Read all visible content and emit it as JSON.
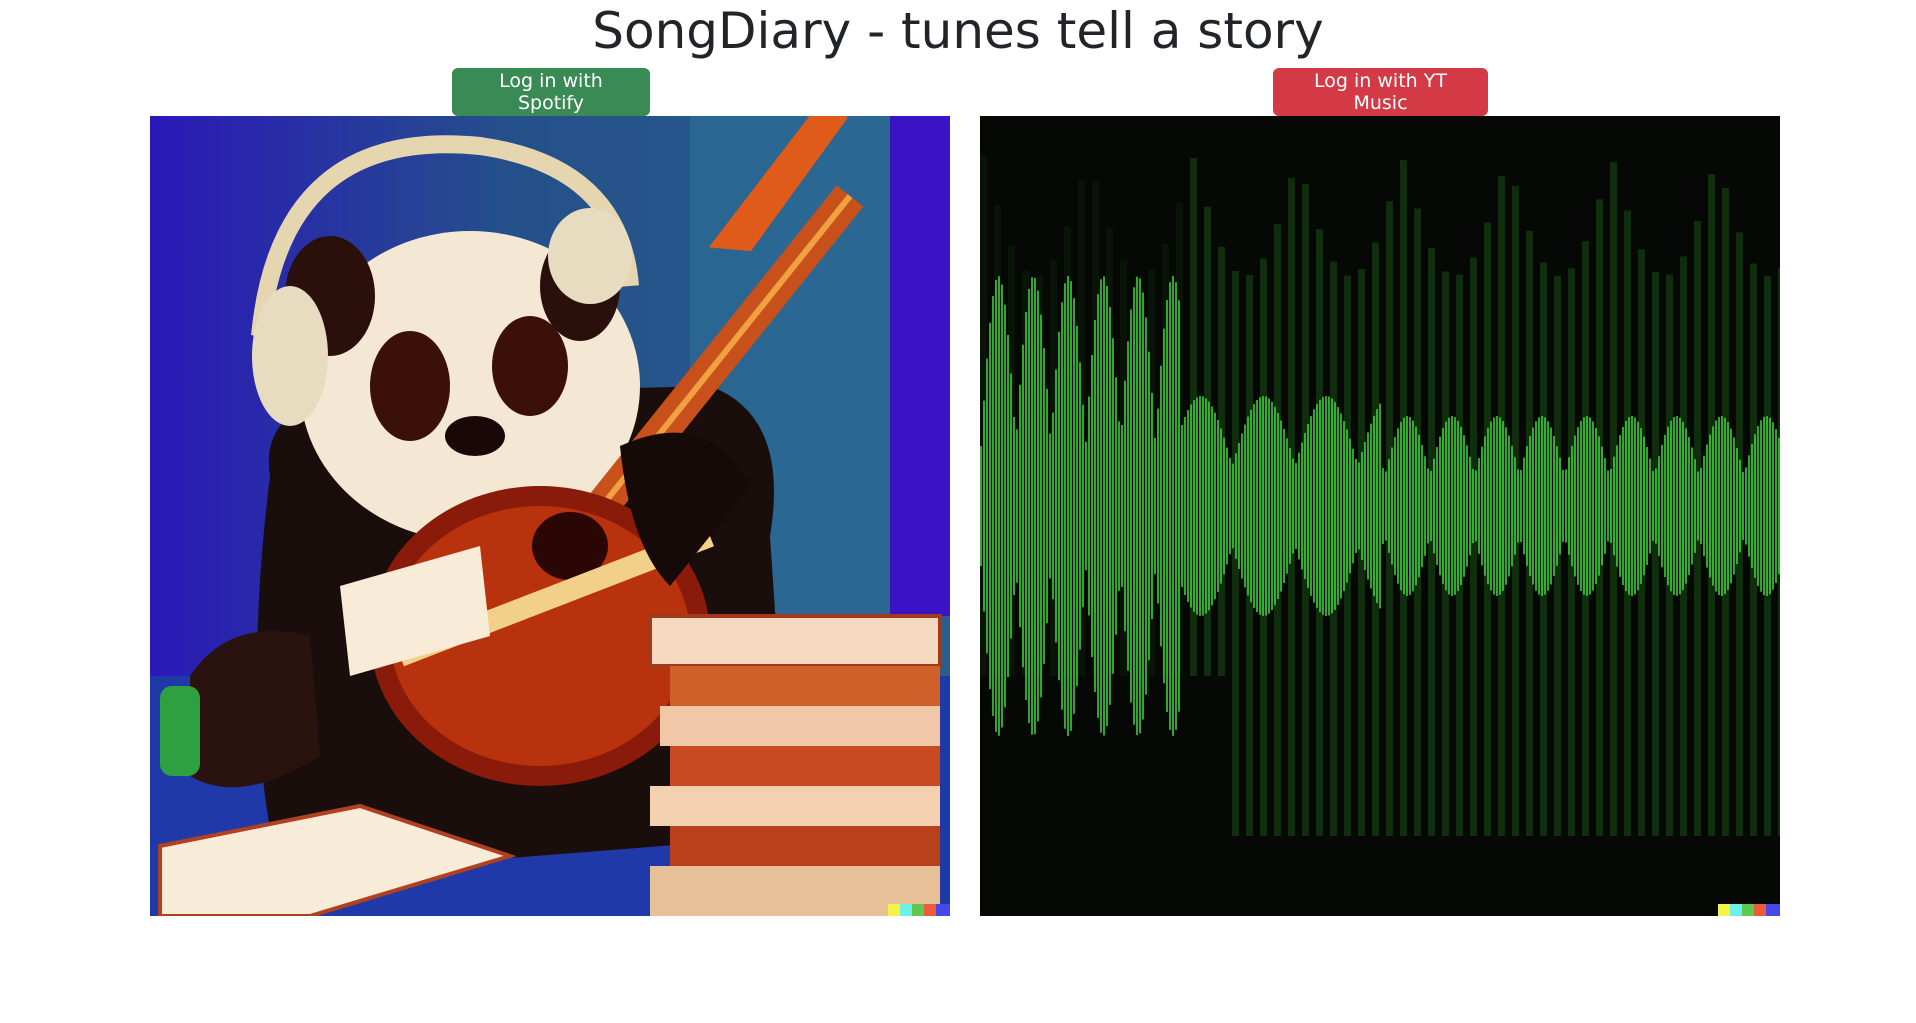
{
  "header": {
    "title": "SongDiary - tunes tell a story"
  },
  "buttons": {
    "spotify_label": "Log in with Spotify",
    "yt_label": "Log in with YT Music"
  },
  "images": {
    "left": "panda-playing-guitar-with-books",
    "right": "green-sound-waveform"
  },
  "colors": {
    "spotify_button": "#3a8a55",
    "yt_button": "#d33a46",
    "waveform_green": "#3ddc3a"
  }
}
